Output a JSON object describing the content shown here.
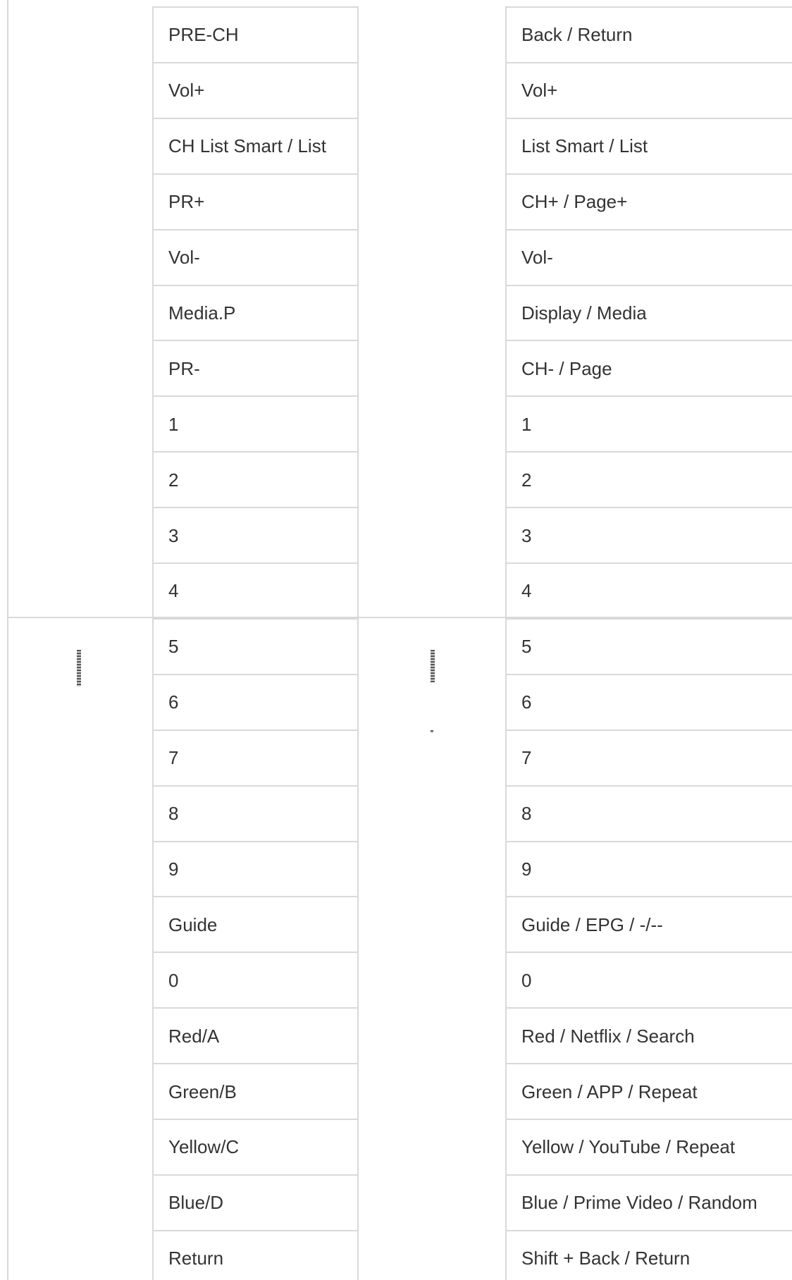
{
  "left_column": {
    "rows": [
      "PRE-CH",
      "Vol+",
      "CH List Smart / List",
      "PR+",
      "Vol-",
      "Media.P",
      "PR-",
      "1",
      "2",
      "3",
      "4",
      "5",
      "6",
      "7",
      "8",
      "9",
      "Guide",
      "0",
      "Red/A",
      "Green/B",
      "Yellow/C",
      "Blue/D",
      "Return"
    ]
  },
  "right_column": {
    "rows": [
      "Back / Return",
      "Vol+",
      "List Smart / List",
      "CH+ / Page+",
      "Vol-",
      "Display / Media",
      "CH- / Page",
      "1",
      "2",
      "3",
      "4",
      "5",
      "6",
      "7",
      "8",
      "9",
      "Guide / EPG / -/--",
      "0",
      "Red / Netflix / Search",
      "Green / APP / Repeat",
      "Yellow / YouTube / Repeat",
      "Blue / Prime Video / Random",
      "Shift + Back / Return"
    ]
  }
}
